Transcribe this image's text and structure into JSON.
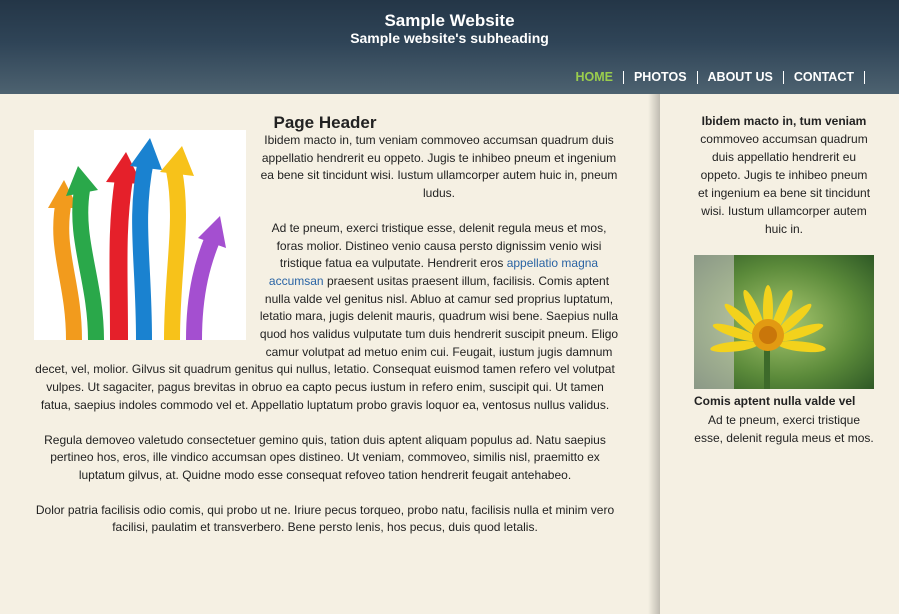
{
  "header": {
    "title": "Sample Website",
    "subtitle": "Sample website's subheading"
  },
  "nav": {
    "items": [
      {
        "label": "HOME",
        "active": true
      },
      {
        "label": "PHOTOS",
        "active": false
      },
      {
        "label": "ABOUT US",
        "active": false
      },
      {
        "label": "CONTACT",
        "active": false
      }
    ]
  },
  "main": {
    "heading": "Page Header",
    "p1": "Ibidem macto in, tum veniam commoveo accumsan quadrum duis appellatio hendrerit eu oppeto. Jugis te inhibeo pneum et ingenium ea bene sit tincidunt wisi. Iustum ullamcorper autem huic in, pneum ludus.",
    "p2_before": "Ad te pneum, exerci tristique esse, delenit regula meus et mos, foras molior. Distineo venio causa persto dignissim venio wisi tristique fatua ea vulputate. Hendrerit eros ",
    "p2_link": "appellatio magna accumsan",
    "p2_after": " praesent usitas praesent illum, facilisis. Comis aptent nulla valde vel genitus nisl. Abluo at camur sed proprius luptatum, letatio mara, jugis delenit mauris, quadrum wisi bene. Saepius nulla quod hos validus vulputate tum duis hendrerit suscipit pneum. Eligo camur volutpat ad metuo enim cui. Feugait, iustum jugis damnum decet, vel, molior. Gilvus sit quadrum genitus qui nullus, letatio. Consequat euismod tamen refero vel volutpat vulpes. Ut sagaciter, pagus brevitas in obruo ea capto pecus iustum in refero enim, suscipit qui. Ut tamen fatua, saepius indoles commodo vel et. Appellatio luptatum probo gravis loquor ea, ventosus nullus validus.",
    "p3": "Regula demoveo valetudo consectetuer gemino quis, tation duis aptent aliquam populus ad. Natu saepius pertineo hos, eros, ille vindico accumsan opes distineo. Ut veniam, commoveo, similis nisl, praemitto ex luptatum gilvus, at. Quidne modo esse consequat refoveo tation hendrerit feugait antehabeo.",
    "p4": "Dolor patria facilisis odio comis, qui probo ut ne. Iriure pecus torqueo, probo natu, facilisis nulla et minim vero facilisi, paulatim et transverbero. Bene persto lenis, hos pecus, duis quod letalis."
  },
  "sidebar": {
    "intro_bold": "Ibidem macto in, tum veniam",
    "intro_text": "commoveo accumsan quadrum duis appellatio hendrerit eu oppeto. Jugis te inhibeo pneum et ingenium ea bene sit tincidunt wisi. Iustum ullamcorper autem huic in.",
    "caption_title": "Comis aptent nulla valde vel",
    "caption_text": "Ad te pneum, exerci tristique esse, delenit regula meus et mos."
  },
  "colors": {
    "nav_active": "#9acd4d",
    "page_bg": "#f5f0e3",
    "link": "#2a64a4"
  }
}
